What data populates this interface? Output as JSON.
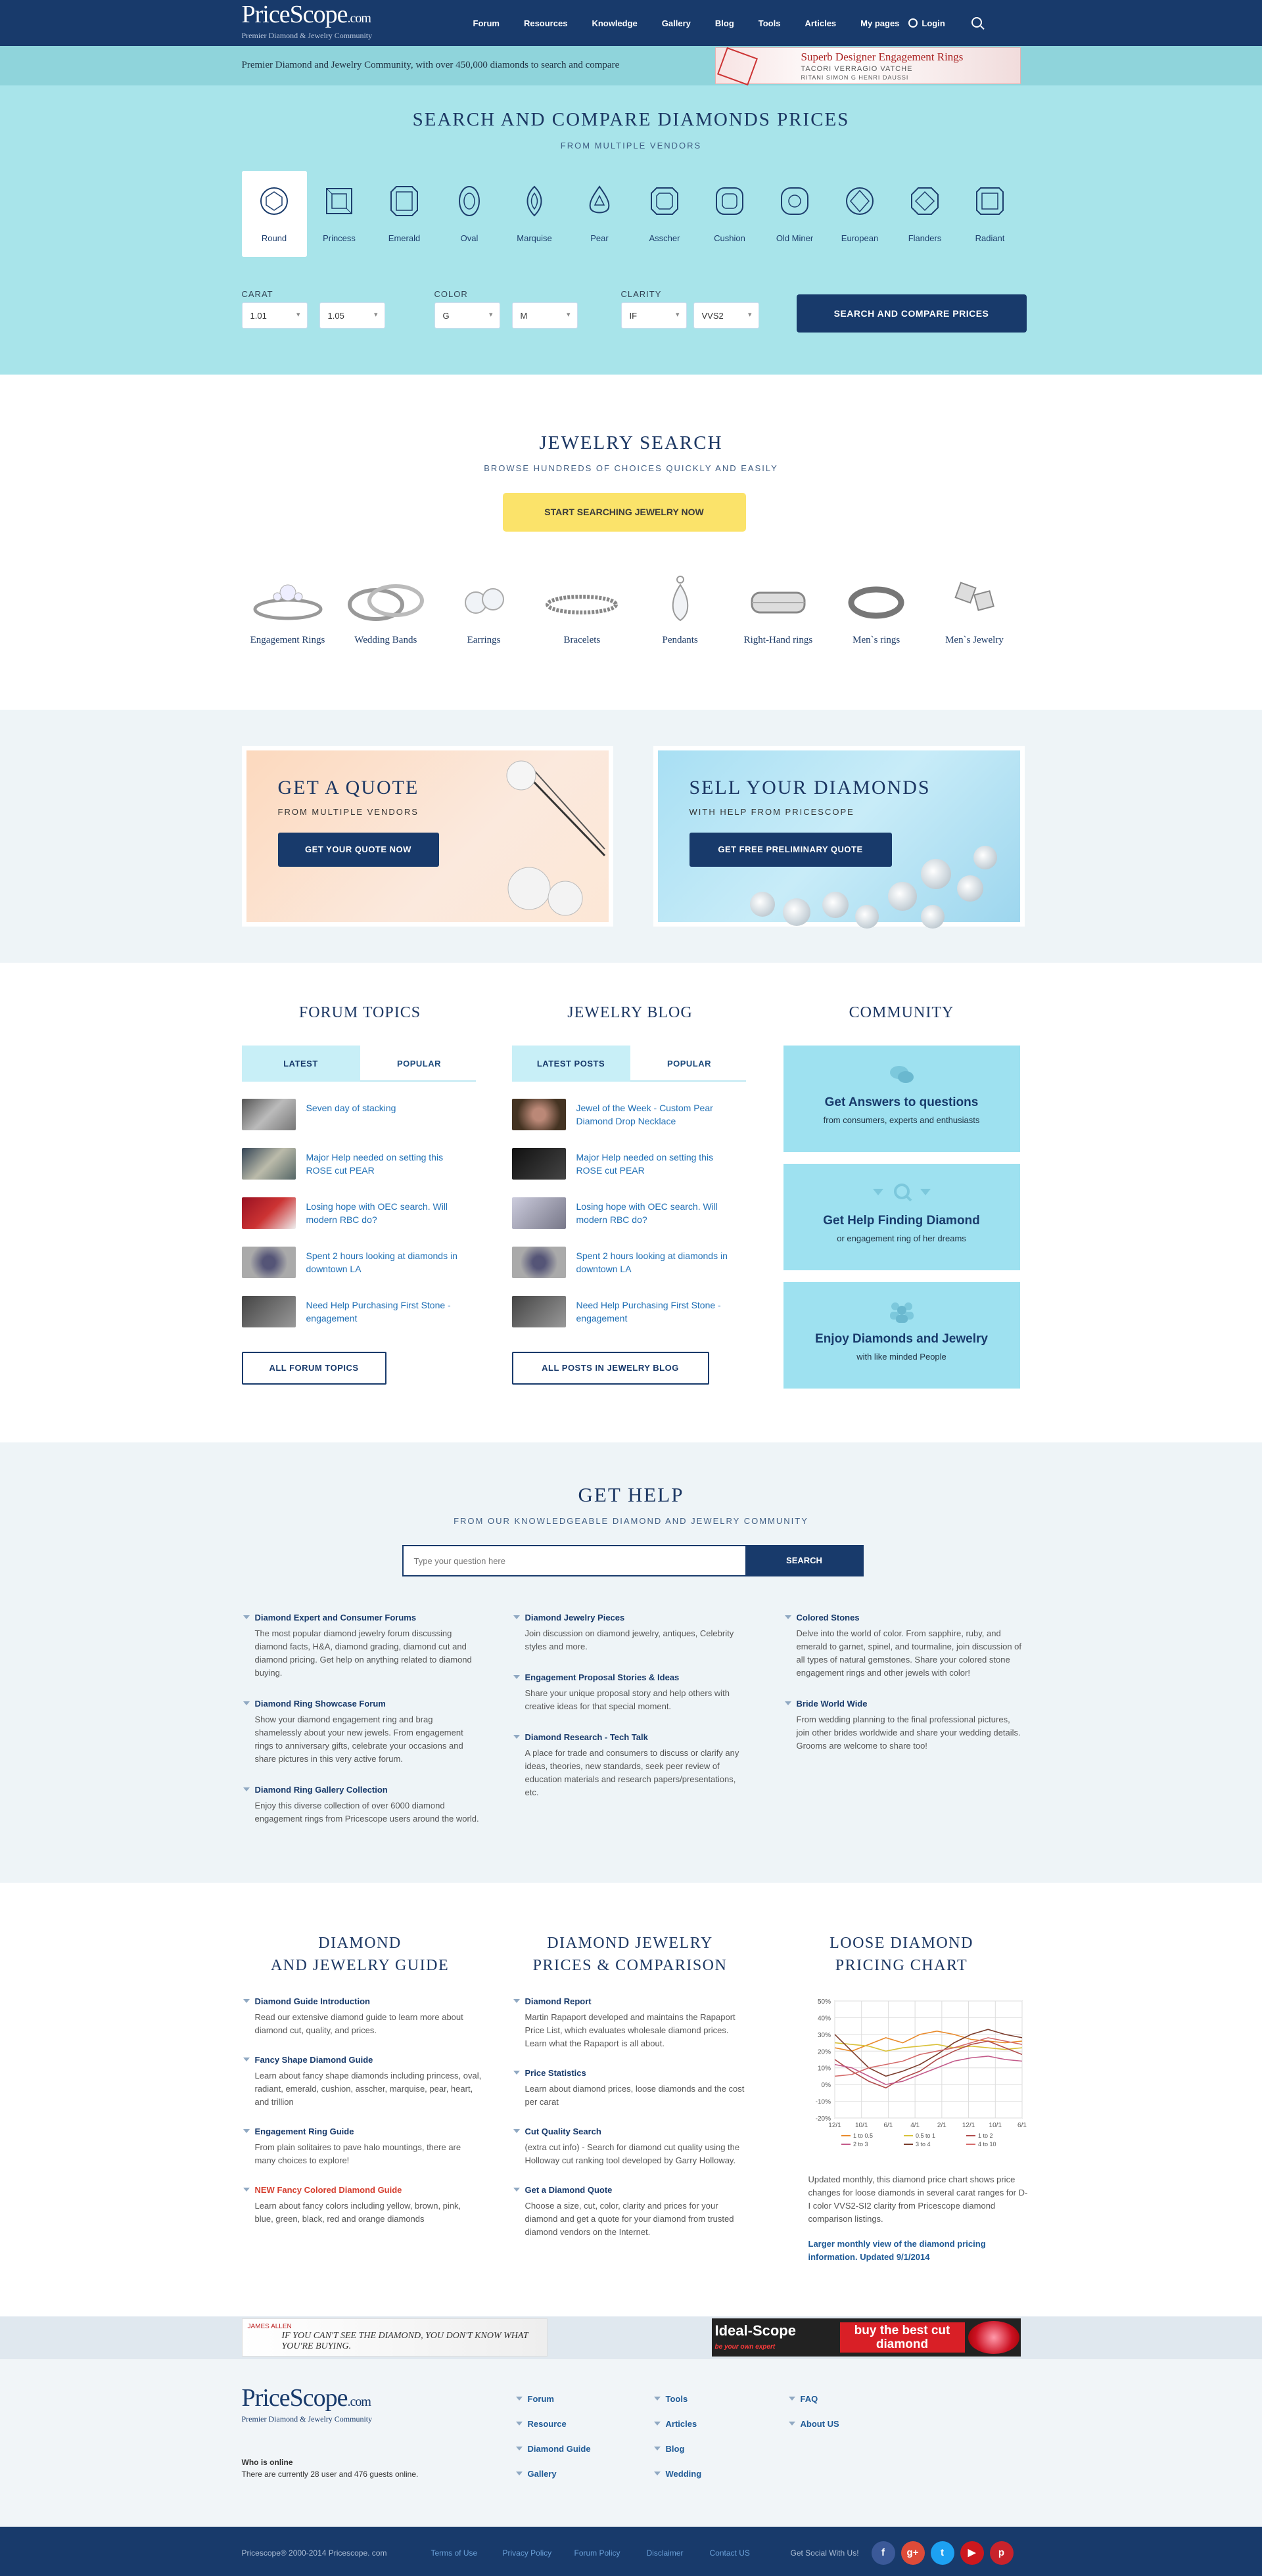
{
  "header": {
    "logo_main": "PriceScope",
    "logo_suffix": ".com",
    "logo_tagline": "Premier Diamond & Jewelry Community",
    "nav": [
      "Forum",
      "Resources",
      "Knowledge",
      "Gallery",
      "Blog",
      "Tools",
      "Articles"
    ],
    "my_pages": "My pages",
    "login": "Login"
  },
  "promo": {
    "text": "Premier Diamond and Jewelry Community, with over 450,000 diamonds to search and compare",
    "ad_title": "Superb Designer Engagement Rings",
    "ad_brands": "TACORI  VERRAGIO  VATCHE",
    "ad_brands2": "RITANI  SIMON G  HENRI DAUSSI"
  },
  "diamond_search": {
    "title": "SEARCH AND COMPARE DIAMONDS PRICES",
    "subtitle": "FROM MULTIPLE VENDORS",
    "shapes": [
      "Round",
      "Princess",
      "Emerald",
      "Oval",
      "Marquise",
      "Pear",
      "Asscher",
      "Cushion",
      "Old Miner",
      "European",
      "Flanders",
      "Radiant"
    ],
    "selected_shape": "Round",
    "carat_label": "CARAT",
    "carat_from": "1.01",
    "carat_to": "1.05",
    "color_label": "COLOR",
    "color_from": "G",
    "color_to": "M",
    "clarity_label": "CLARITY",
    "clarity_from": "IF",
    "clarity_to": "VVS2",
    "button": "SEARCH AND COMPARE PRICES"
  },
  "jewelry_search": {
    "title": "JEWELRY SEARCH",
    "subtitle": "BROWSE HUNDREDS OF CHOICES QUICKLY AND EASILY",
    "button": "START SEARCHING JEWELRY NOW",
    "items": [
      "Engagement Rings",
      "Wedding Bands",
      "Earrings",
      "Bracelets",
      "Pendants",
      "Right-Hand rings",
      "Men`s rings",
      "Men`s Jewelry"
    ]
  },
  "quote": {
    "left_title": "GET A QUOTE",
    "left_sub": "FROM MULTIPLE VENDORS",
    "left_button": "GET YOUR QUOTE NOW",
    "right_title": "SELL YOUR DIAMONDS",
    "right_sub": "WITH HELP FROM PRICESCOPE",
    "right_button": "GET FREE PRELIMINARY QUOTE"
  },
  "forum": {
    "title": "FORUM TOPICS",
    "tab_latest": "LATEST",
    "tab_popular": "POPULAR",
    "posts": [
      "Seven day of stacking",
      "Major Help needed on setting this ROSE cut PEAR",
      "Losing hope with OEC search. Will modern RBC do?",
      "Spent 2 hours looking at diamonds in downtown LA",
      "Need Help Purchasing First Stone - engagement"
    ],
    "button": "ALL FORUM TOPICS"
  },
  "blog": {
    "title": "JEWELRY BLOG",
    "tab_latest": "LATEST POSTS",
    "tab_popular": "POPULAR",
    "posts": [
      "Jewel of the Week - Custom Pear Diamond Drop Necklace",
      "Major Help needed on setting this ROSE cut PEAR",
      "Losing hope with OEC search. Will modern RBC do?",
      "Spent 2 hours looking at diamonds in downtown LA",
      "Need Help Purchasing First Stone - engagement"
    ],
    "button": "ALL POSTS IN JEWELRY BLOG"
  },
  "community": {
    "title": "COMMUNITY",
    "cards": [
      {
        "title": "Get Answers to questions",
        "sub": "from consumers, experts and enthusiasts"
      },
      {
        "title": "Get Help Finding Diamond",
        "sub": "or engagement ring of her dreams"
      },
      {
        "title": "Enjoy Diamonds and Jewelry",
        "sub": "with like minded People"
      }
    ]
  },
  "help": {
    "title": "GET HELP",
    "subtitle": "FROM OUR KNOWLEDGEABLE DIAMOND AND JEWELRY COMMUNITY",
    "placeholder": "Type your question here",
    "button": "SEARCH",
    "col1": [
      {
        "title": "Diamond Expert and Consumer Forums",
        "desc": "The most popular diamond jewelry forum discussing diamond facts, H&A, diamond grading, diamond cut and diamond pricing. Get help on anything related to diamond buying."
      },
      {
        "title": "Diamond Ring Showcase Forum",
        "desc": "Show your diamond engagement ring and brag shamelessly about your new jewels. From engagement rings to anniversary gifts, celebrate your occasions and share pictures in this very active forum."
      },
      {
        "title": "Diamond Ring Gallery Collection",
        "desc": "Enjoy this diverse collection of over 6000 diamond engagement rings from Pricescope users around the world."
      }
    ],
    "col2": [
      {
        "title": "Diamond Jewelry Pieces",
        "desc": "Join discussion on diamond jewelry, antiques, Celebrity styles and more."
      },
      {
        "title": "Engagement Proposal Stories & Ideas",
        "desc": "Share your unique proposal story and help others with creative ideas for that special moment."
      },
      {
        "title": "Diamond Research - Tech Talk",
        "desc": "A place for trade and consumers to discuss or clarify any ideas, theories, new standards, seek peer review of education materials and research papers/presentations, etc."
      }
    ],
    "col3": [
      {
        "title": "Colored Stones",
        "desc": "Delve into the world of color. From sapphire, ruby, and emerald to garnet, spinel, and tourmaline, join discussion of all types of natural gemstones. Share your colored stone engagement rings and other jewels with color!"
      },
      {
        "title": "Bride World Wide",
        "desc": "From wedding planning to the final professional pictures, join other brides worldwide and share your wedding details. Grooms are welcome to share too!"
      }
    ]
  },
  "guide": {
    "col1_title_1": "DIAMOND",
    "col1_title_2": "AND JEWELRY GUIDE",
    "col1": [
      {
        "title": "Diamond Guide Introduction",
        "desc": "Read our extensive diamond guide to learn more about diamond cut, quality, and prices."
      },
      {
        "title": "Fancy Shape Diamond Guide",
        "desc": "Learn about fancy shape diamonds including princess, oval, radiant, emerald, cushion, asscher, marquise, pear, heart, and trillion"
      },
      {
        "title": "Engagement Ring Guide",
        "desc": "From plain solitaires to pave halo mountings, there are many choices to explore!"
      },
      {
        "title": "NEW Fancy Colored Diamond Guide",
        "desc": "Learn about fancy colors including yellow, brown, pink, blue, green, black, red and orange diamonds"
      }
    ],
    "col2_title_1": "DIAMOND JEWELRY",
    "col2_title_2": "PRICES & COMPARISON",
    "col2": [
      {
        "title": "Diamond Report",
        "desc": "Martin Rapaport developed and maintains the Rapaport Price List, which evaluates wholesale diamond prices. Learn what the Rapaport is all about."
      },
      {
        "title": "Price Statistics",
        "desc": "Learn about diamond prices, loose diamonds and the cost per carat"
      },
      {
        "title": "Cut Quality Search",
        "desc": "(extra cut info) - Search for diamond cut quality using the Holloway cut ranking tool developed by Garry Holloway."
      },
      {
        "title": "Get a Diamond Quote",
        "desc": "Choose a size, cut, color, clarity and prices for your diamond and get a quote for your diamond from trusted diamond vendors on the Internet."
      }
    ],
    "col3_title_1": "LOOSE DIAMOND",
    "col3_title_2": "PRICING CHART",
    "chart_note": "Updated monthly, this diamond price chart shows price changes for loose diamonds in several carat ranges for D-I color VVS2-SI2 clarity from Pricescope diamond comparison listings.",
    "chart_link": "Larger monthly view of the diamond pricing information. Updated 9/1/2014"
  },
  "chart_data": {
    "type": "line",
    "x": [
      "12/1",
      "10/1",
      "6/1",
      "4/1",
      "2/1",
      "12/1",
      "10/1",
      "6/1"
    ],
    "y_ticks": [
      "50%",
      "40%",
      "30%",
      "20%",
      "10%",
      "0%",
      "-10%",
      "-20%"
    ],
    "ylim": [
      -20,
      50
    ],
    "grid": true,
    "legend_position": "bottom",
    "series": [
      {
        "name": "1 to 0.5",
        "color": "#e98a2b",
        "values": [
          22,
          20,
          24,
          28,
          25,
          30,
          32,
          30,
          27,
          26,
          25,
          26
        ]
      },
      {
        "name": "0.5 to 1",
        "color": "#d9c13a",
        "values": [
          25,
          24,
          23,
          20,
          22,
          23,
          24,
          22,
          23,
          22,
          21,
          22
        ]
      },
      {
        "name": "1 to 2",
        "color": "#b04b4b",
        "values": [
          15,
          8,
          2,
          -2,
          4,
          8,
          15,
          20,
          24,
          26,
          22,
          18
        ]
      },
      {
        "name": "2 to 3",
        "color": "#c35a8a",
        "values": [
          12,
          10,
          5,
          0,
          2,
          6,
          10,
          14,
          16,
          17,
          15,
          14
        ]
      },
      {
        "name": "3 to 4",
        "color": "#7a3b2b",
        "values": [
          30,
          20,
          10,
          5,
          8,
          12,
          18,
          25,
          30,
          33,
          30,
          28
        ]
      },
      {
        "name": "4 to 10",
        "color": "#d46a6a",
        "values": [
          5,
          6,
          10,
          12,
          14,
          18,
          20,
          22,
          25,
          28,
          26,
          24
        ]
      }
    ]
  },
  "ads": {
    "left_brand": "JAMES ALLEN",
    "left_text": "IF YOU CAN'T SEE THE DIAMOND, YOU DON'T KNOW WHAT YOU'RE BUYING.",
    "right_brand": "Ideal-Scope",
    "right_tag": "be your own expert",
    "right_cta": "buy the best cut diamond"
  },
  "footer": {
    "online_title": "Who is online",
    "online_text": "There are currently 28 user and 476 guests online.",
    "col1": [
      "Forum",
      "Resource",
      "Diamond Guide",
      "Gallery"
    ],
    "col2": [
      "Tools",
      "Articles",
      "Blog",
      "Wedding"
    ],
    "col3": [
      "FAQ",
      "About US"
    ],
    "copyright": "Pricescope® 2000-2014 Pricescope. com",
    "links": [
      "Terms of Use",
      "Privacy Policy",
      "Forum Policy",
      "Disclaimer",
      "Contact US"
    ],
    "social_label": "Get Social With Us!",
    "social": [
      "f",
      "g+",
      "t",
      "▶",
      "p"
    ]
  }
}
